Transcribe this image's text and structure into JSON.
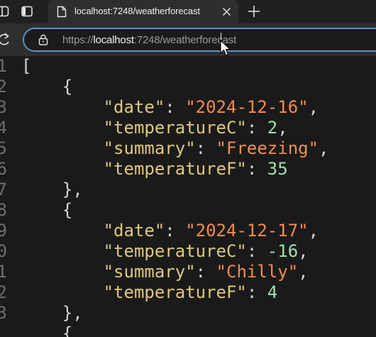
{
  "browser": {
    "tab_title": "localhost:7248/weatherforecast",
    "url_scheme": "https://",
    "url_host": "localhost",
    "url_path": ":7248/weatherforecast",
    "accent_color": "#5d8fc6"
  },
  "icons": {
    "sidebar": "sidebar-toggle-icon",
    "tab_actions": "tab-actions-icon",
    "favicon": "page-icon",
    "close": "close-icon",
    "new_tab": "plus-icon",
    "reload": "reload-icon",
    "lock": "lock-icon"
  },
  "gutter": {
    "line_numbers": [
      "1",
      "2",
      "3",
      "4",
      "5",
      "6",
      "7",
      "8",
      "9",
      "0",
      "1",
      "2",
      "3"
    ]
  },
  "code": {
    "open_bracket": "[",
    "open_brace": "{",
    "close_brace": "},",
    "records": [
      {
        "date_key": "\"date\"",
        "date_value": "\"2024-12-16\"",
        "temperatureC_key": "\"temperatureC\"",
        "temperatureC_value": "2",
        "summary_key": "\"summary\"",
        "summary_value": "\"Freezing\"",
        "temperatureF_key": "\"temperatureF\"",
        "temperatureF_value": "35"
      },
      {
        "date_key": "\"date\"",
        "date_value": "\"2024-12-17\"",
        "temperatureC_key": "\"temperatureC\"",
        "temperatureC_value": "-16",
        "summary_key": "\"summary\"",
        "summary_value": "\"Chilly\"",
        "temperatureF_key": "\"temperatureF\"",
        "temperatureF_value": "4"
      }
    ]
  }
}
